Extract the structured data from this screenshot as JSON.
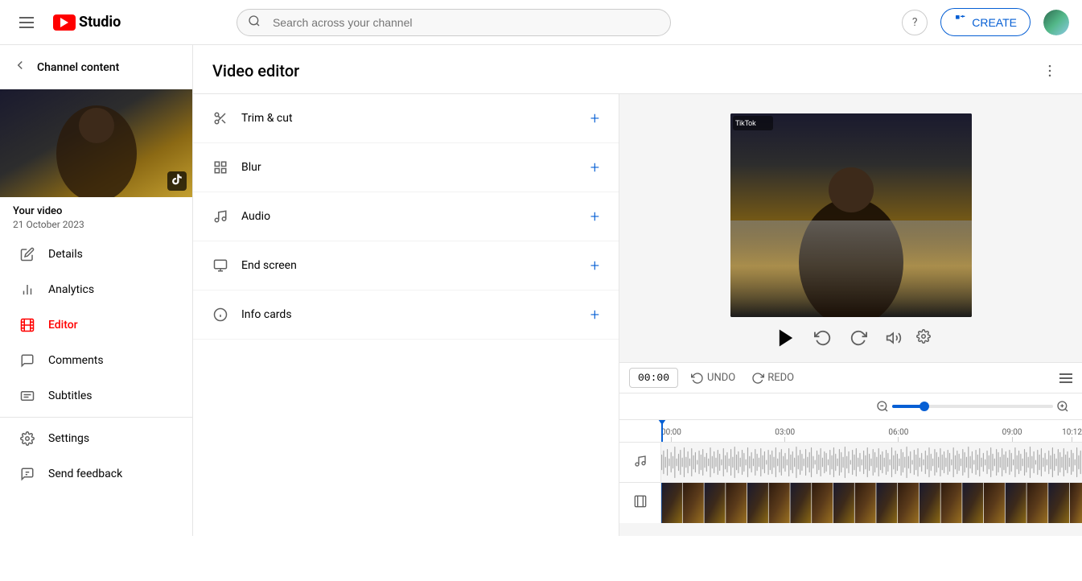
{
  "app": {
    "name": "YouTube Studio",
    "logo_text": "Studio"
  },
  "topbar": {
    "search_placeholder": "Search across your channel",
    "help_label": "?",
    "create_label": "CREATE",
    "create_icon": "+"
  },
  "sidebar": {
    "channel_content_label": "Channel content",
    "video_title": "Your video",
    "video_date": "21 October 2023",
    "nav_items": [
      {
        "id": "details",
        "label": "Details",
        "icon": "pencil"
      },
      {
        "id": "analytics",
        "label": "Analytics",
        "icon": "chart"
      },
      {
        "id": "editor",
        "label": "Editor",
        "icon": "film",
        "active": true
      },
      {
        "id": "comments",
        "label": "Comments",
        "icon": "comment"
      },
      {
        "id": "subtitles",
        "label": "Subtitles",
        "icon": "subtitles"
      }
    ],
    "bottom_items": [
      {
        "id": "settings",
        "label": "Settings",
        "icon": "gear"
      },
      {
        "id": "feedback",
        "label": "Send feedback",
        "icon": "feedback"
      }
    ]
  },
  "editor": {
    "title": "Video editor",
    "tools": [
      {
        "id": "trim-cut",
        "label": "Trim & cut",
        "icon": "scissors"
      },
      {
        "id": "blur",
        "label": "Blur",
        "icon": "grid"
      },
      {
        "id": "audio",
        "label": "Audio",
        "icon": "music-note"
      },
      {
        "id": "end-screen",
        "label": "End screen",
        "icon": "end-screen"
      },
      {
        "id": "info-cards",
        "label": "Info cards",
        "icon": "info"
      }
    ]
  },
  "timeline": {
    "timecode": "00:00",
    "undo_label": "UNDO",
    "redo_label": "REDO",
    "ruler_marks": [
      "00:00",
      "03:00",
      "06:00",
      "09:00",
      "10:12"
    ],
    "duration": "10:12"
  },
  "colors": {
    "accent": "#065fd4",
    "red": "#ff0000",
    "text_primary": "#030303",
    "text_secondary": "#606060",
    "border": "#e5e5e5",
    "bg_light": "#f5f5f5"
  }
}
